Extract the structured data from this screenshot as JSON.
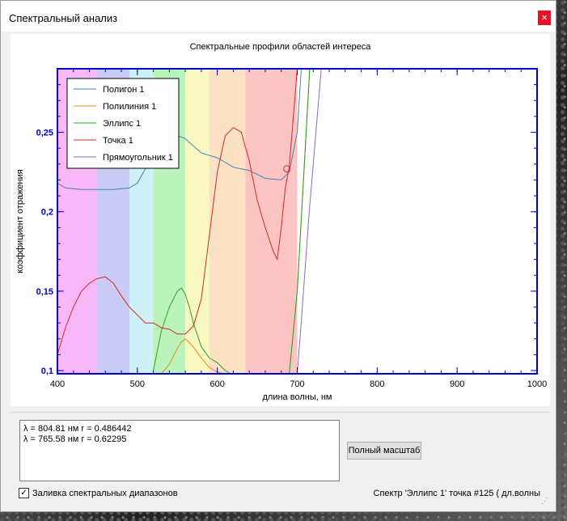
{
  "window": {
    "title": "Спектральный анализ",
    "close_glyph": "×"
  },
  "colors": {
    "polygon": "#4a7fb8",
    "polyline": "#e98c1a",
    "ellipse": "#2ca02c",
    "point": "#d62728",
    "rectangle": "#9467bd",
    "axis": "#0000cc",
    "bands": [
      "#f6a6f6",
      "#bdbdf4",
      "#c4ecf6",
      "#aaf0aa",
      "#f6f6b0",
      "#fbd9b5",
      "#fdb5b5"
    ]
  },
  "chart_data": {
    "type": "line",
    "title": "Спектральные профили областей интереса",
    "xlabel": "длина волны, нм",
    "ylabel": "коэффициент отражения",
    "xlim": [
      400,
      1000
    ],
    "ylim": [
      0.098,
      0.29
    ],
    "x_ticks": [
      "400",
      "500",
      "600",
      "700",
      "800",
      "900",
      "1000"
    ],
    "y_ticks": [
      "0,1",
      "0,15",
      "0,2",
      "0,25"
    ],
    "y_tick_values": [
      0.1,
      0.15,
      0.2,
      0.25
    ],
    "x_tick_values": [
      400,
      500,
      600,
      700,
      800,
      900,
      1000
    ],
    "bands": [
      [
        400,
        450
      ],
      [
        450,
        490
      ],
      [
        490,
        520
      ],
      [
        520,
        560
      ],
      [
        560,
        590
      ],
      [
        590,
        635
      ],
      [
        635,
        700
      ]
    ],
    "legend_position": "top-left",
    "series": [
      {
        "name": "Полигон 1",
        "color_key": "polygon",
        "x": [
          400,
          410,
          430,
          450,
          470,
          490,
          500,
          510,
          520,
          530,
          540,
          550,
          560,
          580,
          600,
          620,
          640,
          660,
          680,
          690,
          700,
          705,
          715
        ],
        "y": [
          0.218,
          0.215,
          0.214,
          0.214,
          0.214,
          0.215,
          0.218,
          0.227,
          0.238,
          0.244,
          0.247,
          0.248,
          0.246,
          0.237,
          0.234,
          0.228,
          0.226,
          0.221,
          0.22,
          0.225,
          0.25,
          0.29,
          0.33
        ]
      },
      {
        "name": "Полилиния 1",
        "color_key": "polyline",
        "x": [
          530,
          540,
          550,
          555,
          560,
          570,
          580,
          590,
          600,
          610,
          620,
          630,
          650,
          670,
          690,
          700,
          720
        ],
        "y": [
          0.098,
          0.104,
          0.114,
          0.118,
          0.12,
          0.115,
          0.108,
          0.102,
          0.099,
          0.098,
          0.097,
          0.097,
          0.098,
          0.098,
          0.098,
          0.15,
          0.33
        ]
      },
      {
        "name": "Эллипс 1",
        "color_key": "ellipse",
        "x": [
          520,
          530,
          540,
          550,
          555,
          560,
          565,
          570,
          580,
          590,
          600,
          610,
          620,
          630,
          650,
          670,
          690,
          700,
          720
        ],
        "y": [
          0.1,
          0.125,
          0.14,
          0.15,
          0.152,
          0.148,
          0.14,
          0.13,
          0.115,
          0.108,
          0.105,
          0.1,
          0.097,
          0.097,
          0.098,
          0.098,
          0.098,
          0.15,
          0.33
        ]
      },
      {
        "name": "Точка 1",
        "color_key": "point",
        "x": [
          400,
          410,
          420,
          430,
          440,
          450,
          460,
          470,
          480,
          490,
          500,
          510,
          520,
          530,
          540,
          550,
          560,
          570,
          580,
          590,
          600,
          610,
          620,
          630,
          640,
          650,
          660,
          670,
          675,
          680,
          685,
          690,
          700
        ],
        "y": [
          0.11,
          0.127,
          0.14,
          0.15,
          0.155,
          0.158,
          0.159,
          0.155,
          0.147,
          0.14,
          0.135,
          0.13,
          0.13,
          0.127,
          0.126,
          0.123,
          0.123,
          0.128,
          0.145,
          0.185,
          0.225,
          0.248,
          0.253,
          0.25,
          0.232,
          0.207,
          0.19,
          0.175,
          0.17,
          0.19,
          0.215,
          0.228,
          0.29
        ]
      },
      {
        "name": "Прямоугольник 1",
        "color_key": "rectangle",
        "x": [
          700,
          705,
          715,
          730,
          745
        ],
        "y": [
          0.098,
          0.13,
          0.2,
          0.29,
          0.35
        ]
      }
    ],
    "marker": {
      "x": 687,
      "y": 0.227
    }
  },
  "readout": {
    "lines": [
      "λ = 804.81 нм r = 0.486442",
      "λ = 765.58 нм r = 0.62295"
    ]
  },
  "controls": {
    "full_scale_label": "Полный масштаб",
    "fill_bands_label": "Заливка спектральных диапазонов",
    "fill_bands_checked": true,
    "check_glyph": "✓"
  },
  "status": {
    "text": "Спектр 'Эллипс 1' точка #125 ( дл.волны"
  }
}
